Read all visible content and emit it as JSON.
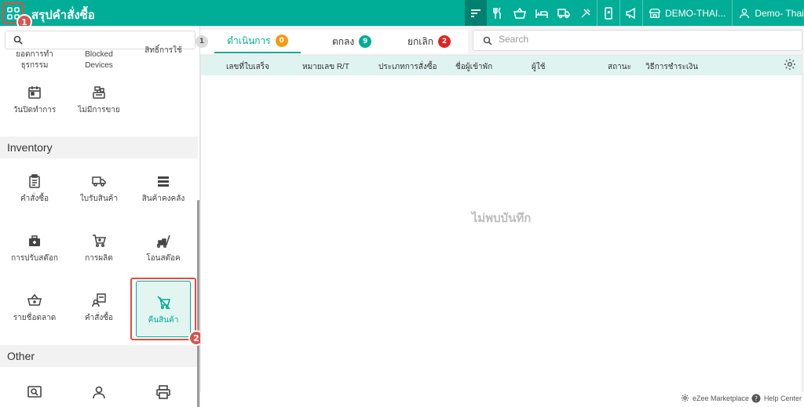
{
  "topbar": {
    "title": "สรุปคำสั่งซื้อ",
    "property": "DEMO-THAI...",
    "user": "Demo- Thail...",
    "icons": [
      "sort-icon",
      "restaurant-icon",
      "basket-icon",
      "bed-icon",
      "truck-icon",
      "tools-icon",
      "mobile-icon",
      "megaphone-icon",
      "store-icon",
      "user-icon"
    ]
  },
  "annotations": {
    "step1": "1",
    "step2": "2"
  },
  "sidebar": {
    "search_placeholder": "",
    "partial_top": [
      "ยอดการทำธุรกรรม",
      "Blocked Devices",
      "สิทธิ์การใช้"
    ],
    "items_top": [
      {
        "label": "วันปิดทำการ",
        "icon": "calendar-icon"
      },
      {
        "label": "ไม่มีการขาย",
        "icon": "cash-register-icon"
      }
    ],
    "inventory_title": "Inventory",
    "inventory_items": [
      {
        "label": "คำสั่งซื้อ",
        "icon": "clipboard-icon"
      },
      {
        "label": "ใบรับสินค้า",
        "icon": "truck-icon"
      },
      {
        "label": "สินค้าคงคลัง",
        "icon": "list-icon"
      },
      {
        "label": "การปรับสต๊อก",
        "icon": "toolbox-icon"
      },
      {
        "label": "การผลิต",
        "icon": "cart-icon"
      },
      {
        "label": "โอนสต๊อค",
        "icon": "trolley-icon"
      },
      {
        "label": "รายชื่อตลาด",
        "icon": "basket-icon"
      },
      {
        "label": "คำสั่งซื้อ",
        "icon": "user-board-icon"
      },
      {
        "label": "คืนสินค้า",
        "icon": "cart-off-icon"
      }
    ],
    "other_title": "Other"
  },
  "tabs": {
    "first_count": "1",
    "items": [
      {
        "label": "ดำเนินการ",
        "count": "0",
        "color": "#f39c12"
      },
      {
        "label": "ตกลง",
        "count": "9",
        "color": "#00ad96"
      },
      {
        "label": "ยกเลิก",
        "count": "2",
        "color": "#e02424"
      }
    ]
  },
  "search": {
    "placeholder": "Search"
  },
  "table": {
    "columns": [
      "เลขที่ใบเสร็จ",
      "หมายเลข R/T",
      "ประเภทการสั่งซื้อ",
      "ชื่อผู้เข้าพัก",
      "ผู้ใช้",
      "สถานะ",
      "วิธีการชำระเงิน"
    ],
    "empty_text": "ไม่พบบันทึก"
  },
  "footer": {
    "marketplace": "eZee Marketplace",
    "help": "Help Center"
  },
  "colors": {
    "brand": "#00ad96",
    "highlight": "#e74c3c"
  }
}
